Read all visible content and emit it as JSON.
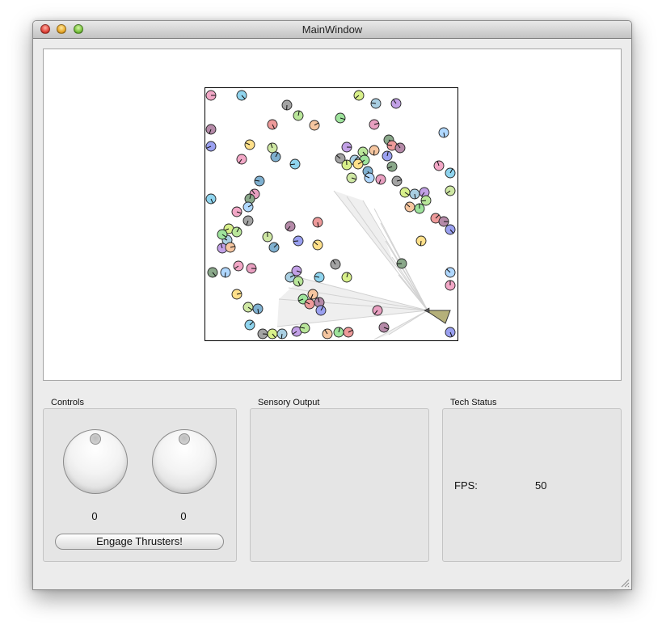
{
  "window": {
    "title": "MainWindow"
  },
  "controls": {
    "label": "Controls",
    "knobs": [
      {
        "value": "0"
      },
      {
        "value": "0"
      }
    ],
    "thrust_button_label": "Engage Thrusters!"
  },
  "sensory": {
    "label": "Sensory Output"
  },
  "tech": {
    "label": "Tech Status",
    "fps_label": "FPS:",
    "fps_value": "50"
  },
  "simulation": {
    "agent_heading_deg": 180,
    "ray_count": 14
  },
  "colors": {
    "background": "#ececec",
    "panel": "#e5e5e5",
    "agent": "#b5b07a"
  }
}
